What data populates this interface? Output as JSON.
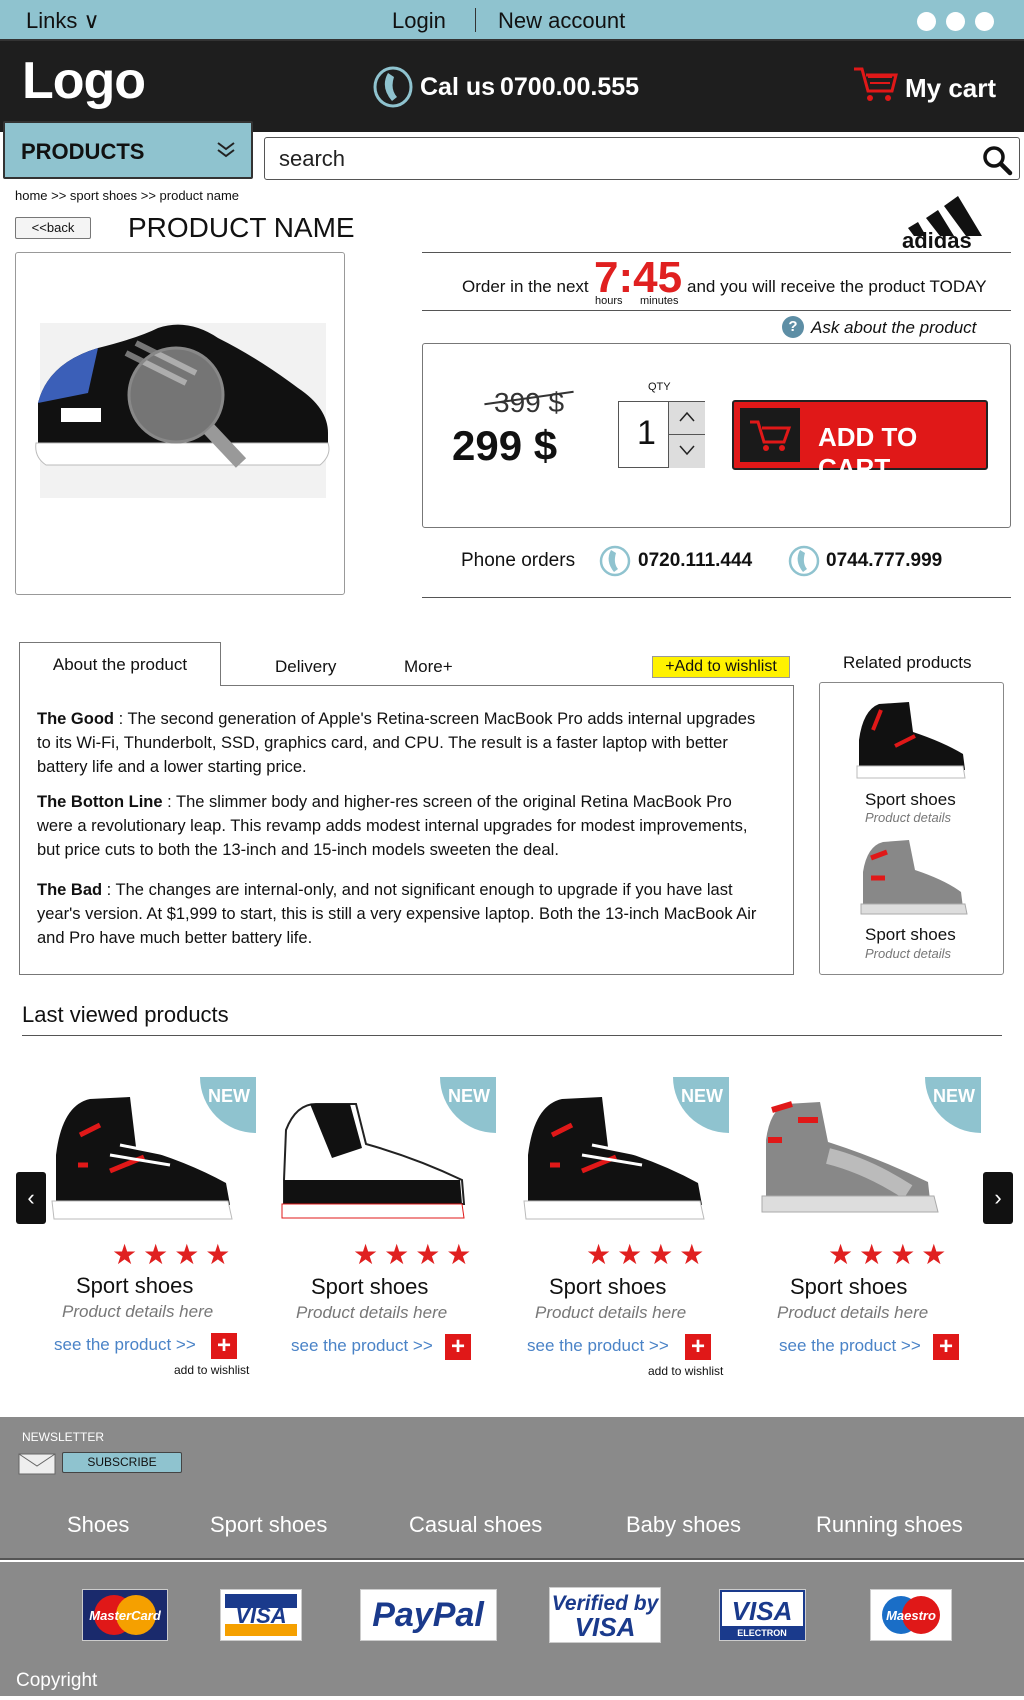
{
  "topbar": {
    "links": "Links ∨",
    "login": "Login",
    "new_account": "New account"
  },
  "header": {
    "logo": "Logo",
    "call_label": "Cal us",
    "call_number": "0700.00.555",
    "cart_label": "My cart"
  },
  "nav": {
    "products": "PRODUCTS",
    "search_value": "search"
  },
  "breadcrumb": "home >> sport shoes >> product name",
  "back": "<<back",
  "product": {
    "name": "PRODUCT NAME",
    "brand": "adidas",
    "order_prefix": "Order in the next",
    "timer": "7:45",
    "timer_hours": "hours",
    "timer_minutes": "minutes",
    "order_suffix": "and you will receive the product TODAY",
    "ask": "Ask about the product",
    "old_price": "399 $",
    "price": "299 $",
    "qty_label": "QTY",
    "qty": "1",
    "add_to_cart": "ADD TO CART",
    "phone_orders": "Phone orders",
    "phone1": "0720.111.444",
    "phone2": "0744.777.999"
  },
  "tabs": {
    "about": "About the product",
    "delivery": "Delivery",
    "more": "More+",
    "wishlist": "+Add to wishlist"
  },
  "about": {
    "good_title": "The Good",
    "good_text": " : The second generation of Apple's Retina-screen MacBook Pro adds internal upgrades to its Wi-Fi, Thunderbolt, SSD, graphics card, and CPU. The result is a faster laptop with better battery life and a lower starting price.",
    "bottom_title": "The Botton Line",
    "bottom_text": " : The slimmer body and higher-res screen of the original Retina MacBook Pro were a revolutionary leap. This revamp adds modest internal upgrades for modest improvements, but price cuts to both the 13-inch and 15-inch models sweeten the deal.",
    "bad_title": "The Bad",
    "bad_text": " : The changes are internal-only, and not significant enough to upgrade if you have last year's version. At $1,999 to start, this is still a very expensive laptop. Both the 13-inch MacBook Air and Pro have much better battery life."
  },
  "related": {
    "title": "Related products",
    "items": [
      {
        "name": "Sport shoes",
        "details": "Product details"
      },
      {
        "name": "Sport shoes",
        "details": "Product details"
      }
    ]
  },
  "last_viewed": {
    "title": "Last viewed products",
    "badge": "NEW",
    "stars": "★★★★",
    "prev": "‹",
    "next": "›",
    "items": [
      {
        "name": "Sport shoes",
        "details": "Product details here",
        "link": "see the product  >>",
        "add_wishlist": "add to wishlist"
      },
      {
        "name": "Sport shoes",
        "details": "Product details here",
        "link": "see the product  >>"
      },
      {
        "name": "Sport shoes",
        "details": "Product details here",
        "link": "see the product  >>",
        "add_wishlist": "add to wishlist"
      },
      {
        "name": "Sport shoes",
        "details": "Product details here",
        "link": "see the product  >>"
      }
    ]
  },
  "footer": {
    "newsletter": "NEWSLETTER",
    "subscribe": "SUBSCRIBE",
    "categories": [
      "Shoes",
      "Sport shoes",
      "Casual shoes",
      "Baby shoes",
      "Running shoes"
    ],
    "payments": {
      "mastercard": "MasterCard",
      "visa": "VISA",
      "paypal": "PayPal",
      "verified_1": "Verified by",
      "verified_2": "VISA",
      "visa_electron": "VISA",
      "electron": "ELECTRON",
      "maestro": "Maestro"
    },
    "copyright": "Copyright"
  },
  "colors": {
    "accent": "#8fc3cf",
    "header_bg": "#1e1e1e",
    "red": "#e01818",
    "footer_bg": "#8a8a8a"
  }
}
